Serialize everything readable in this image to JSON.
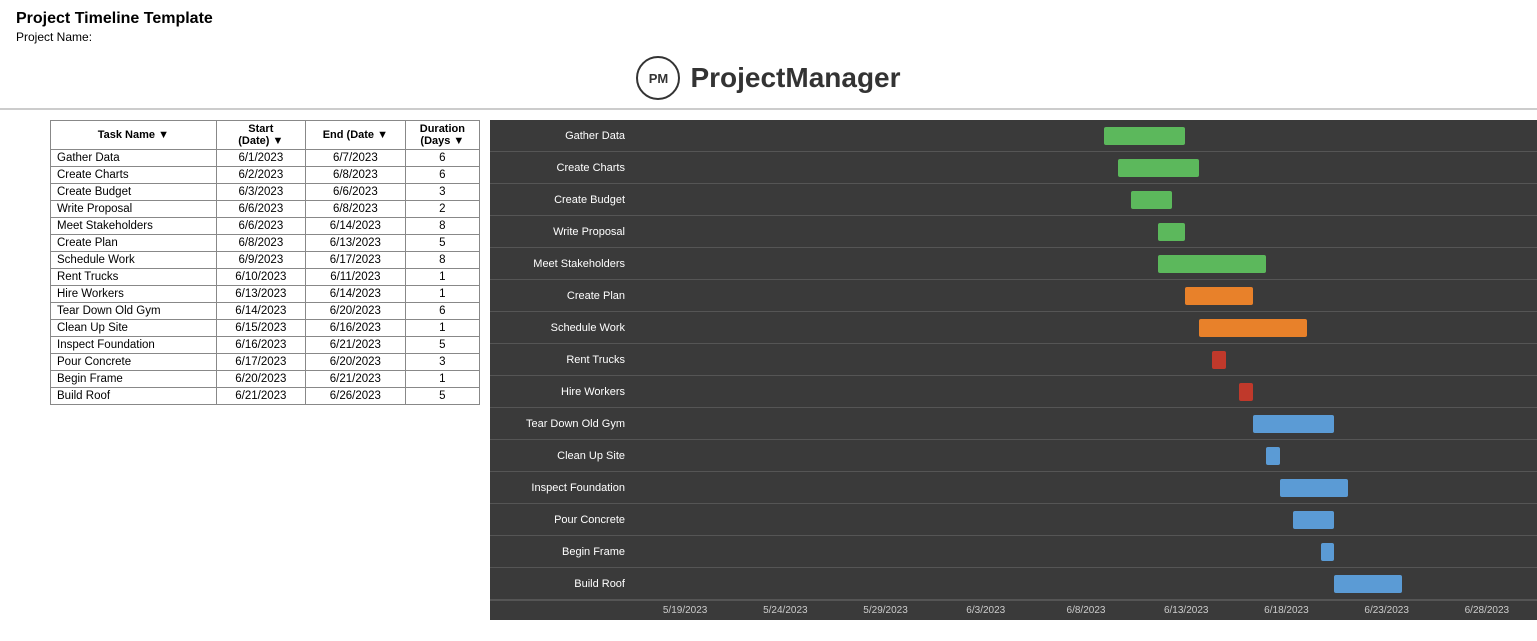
{
  "header": {
    "title": "Project Timeline Template",
    "project_name_label": "Project Name:"
  },
  "brand": {
    "logo_text": "PM",
    "name": "ProjectManager"
  },
  "table": {
    "columns": [
      "Task Name",
      "Start\n(Date)",
      "End  (Date)",
      "Duration\n(Days)"
    ],
    "rows": [
      {
        "task": "Gather Data",
        "start": "6/1/2023",
        "end": "6/7/2023",
        "dur": "6"
      },
      {
        "task": "Create Charts",
        "start": "6/2/2023",
        "end": "6/8/2023",
        "dur": "6"
      },
      {
        "task": "Create Budget",
        "start": "6/3/2023",
        "end": "6/6/2023",
        "dur": "3"
      },
      {
        "task": "Write Proposal",
        "start": "6/6/2023",
        "end": "6/8/2023",
        "dur": "2"
      },
      {
        "task": "Meet Stakeholders",
        "start": "6/6/2023",
        "end": "6/14/2023",
        "dur": "8"
      },
      {
        "task": "Create Plan",
        "start": "6/8/2023",
        "end": "6/13/2023",
        "dur": "5"
      },
      {
        "task": "Schedule Work",
        "start": "6/9/2023",
        "end": "6/17/2023",
        "dur": "8"
      },
      {
        "task": "Rent Trucks",
        "start": "6/10/2023",
        "end": "6/11/2023",
        "dur": "1"
      },
      {
        "task": "Hire Workers",
        "start": "6/13/2023",
        "end": "6/14/2023",
        "dur": "1"
      },
      {
        "task": "Tear Down Old Gym",
        "start": "6/14/2023",
        "end": "6/20/2023",
        "dur": "6"
      },
      {
        "task": "Clean Up Site",
        "start": "6/15/2023",
        "end": "6/16/2023",
        "dur": "1"
      },
      {
        "task": "Inspect Foundation",
        "start": "6/16/2023",
        "end": "6/21/2023",
        "dur": "5"
      },
      {
        "task": "Pour Concrete",
        "start": "6/17/2023",
        "end": "6/20/2023",
        "dur": "3"
      },
      {
        "task": "Begin Frame",
        "start": "6/20/2023",
        "end": "6/21/2023",
        "dur": "1"
      },
      {
        "task": "Build Roof",
        "start": "6/21/2023",
        "end": "6/26/2023",
        "dur": "5"
      }
    ]
  },
  "gantt": {
    "x_labels": [
      "5/19/2023",
      "5/24/2023",
      "5/29/2023",
      "6/3/2023",
      "6/8/2023",
      "6/13/2023",
      "6/18/2023",
      "6/23/2023",
      "6/28/2023"
    ],
    "rows": [
      {
        "label": "Gather Data",
        "left_pct": 52,
        "width_pct": 9,
        "color": "#5cb85c"
      },
      {
        "label": "Create Charts",
        "left_pct": 53.5,
        "width_pct": 9,
        "color": "#5cb85c"
      },
      {
        "label": "Create Budget",
        "left_pct": 55,
        "width_pct": 4.5,
        "color": "#5cb85c"
      },
      {
        "label": "Write Proposal",
        "left_pct": 58,
        "width_pct": 3,
        "color": "#5cb85c"
      },
      {
        "label": "Meet Stakeholders",
        "left_pct": 58,
        "width_pct": 12,
        "color": "#5cb85c"
      },
      {
        "label": "Create Plan",
        "left_pct": 61,
        "width_pct": 7.5,
        "color": "#e8812a"
      },
      {
        "label": "Schedule Work",
        "left_pct": 62.5,
        "width_pct": 12,
        "color": "#e8812a"
      },
      {
        "label": "Rent Trucks",
        "left_pct": 64,
        "width_pct": 1.5,
        "color": "#c0392b"
      },
      {
        "label": "Hire Workers",
        "left_pct": 67,
        "width_pct": 1.5,
        "color": "#c0392b"
      },
      {
        "label": "Tear Down Old Gym",
        "left_pct": 68.5,
        "width_pct": 9,
        "color": "#5b9bd5"
      },
      {
        "label": "Clean Up Site",
        "left_pct": 70,
        "width_pct": 1.5,
        "color": "#5b9bd5"
      },
      {
        "label": "Inspect Foundation",
        "left_pct": 71.5,
        "width_pct": 7.5,
        "color": "#5b9bd5"
      },
      {
        "label": "Pour Concrete",
        "left_pct": 73,
        "width_pct": 4.5,
        "color": "#5b9bd5"
      },
      {
        "label": "Begin Frame",
        "left_pct": 76,
        "width_pct": 1.5,
        "color": "#5b9bd5"
      },
      {
        "label": "Build Roof",
        "left_pct": 77.5,
        "width_pct": 7.5,
        "color": "#5b9bd5"
      }
    ]
  }
}
